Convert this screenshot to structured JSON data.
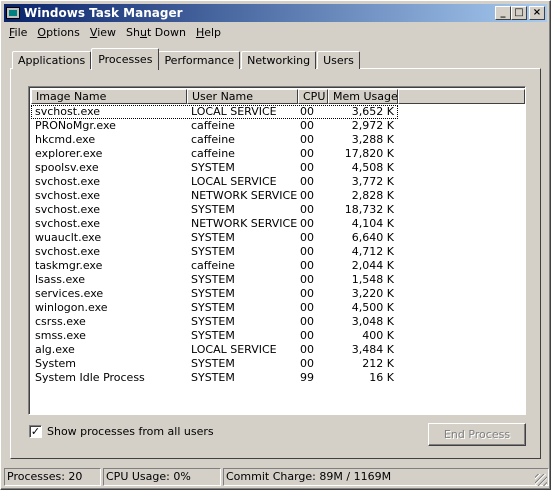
{
  "window": {
    "title": "Windows Task Manager"
  },
  "titlebar_buttons": {
    "minimize": "_",
    "maximize": "□",
    "close": "×"
  },
  "menu": [
    {
      "label": "File",
      "accel": "F",
      "rest": "ile"
    },
    {
      "label": "Options",
      "accel": "O",
      "rest": "ptions"
    },
    {
      "label": "View",
      "accel": "V",
      "rest": "iew"
    },
    {
      "label": "Shut Down",
      "accel": "",
      "pre": "Sh",
      "ul": "u",
      "post": "t Down"
    },
    {
      "label": "Help",
      "accel": "H",
      "rest": "elp"
    }
  ],
  "tabs": [
    "Applications",
    "Processes",
    "Performance",
    "Networking",
    "Users"
  ],
  "active_tab": "Processes",
  "columns": [
    "Image Name",
    "User Name",
    "CPU",
    "Mem Usage"
  ],
  "processes": [
    [
      "svchost.exe",
      "LOCAL SERVICE",
      "00",
      "3,652 K"
    ],
    [
      "PRONoMgr.exe",
      "caffeine",
      "00",
      "2,972 K"
    ],
    [
      "hkcmd.exe",
      "caffeine",
      "00",
      "3,288 K"
    ],
    [
      "explorer.exe",
      "caffeine",
      "00",
      "17,820 K"
    ],
    [
      "spoolsv.exe",
      "SYSTEM",
      "00",
      "4,508 K"
    ],
    [
      "svchost.exe",
      "LOCAL SERVICE",
      "00",
      "3,772 K"
    ],
    [
      "svchost.exe",
      "NETWORK SERVICE",
      "00",
      "2,828 K"
    ],
    [
      "svchost.exe",
      "SYSTEM",
      "00",
      "18,732 K"
    ],
    [
      "svchost.exe",
      "NETWORK SERVICE",
      "00",
      "4,104 K"
    ],
    [
      "wuauclt.exe",
      "SYSTEM",
      "00",
      "6,640 K"
    ],
    [
      "svchost.exe",
      "SYSTEM",
      "00",
      "4,712 K"
    ],
    [
      "taskmgr.exe",
      "caffeine",
      "00",
      "2,044 K"
    ],
    [
      "lsass.exe",
      "SYSTEM",
      "00",
      "1,548 K"
    ],
    [
      "services.exe",
      "SYSTEM",
      "00",
      "3,220 K"
    ],
    [
      "winlogon.exe",
      "SYSTEM",
      "00",
      "4,500 K"
    ],
    [
      "csrss.exe",
      "SYSTEM",
      "00",
      "3,048 K"
    ],
    [
      "smss.exe",
      "SYSTEM",
      "00",
      "400 K"
    ],
    [
      "alg.exe",
      "LOCAL SERVICE",
      "00",
      "3,484 K"
    ],
    [
      "System",
      "SYSTEM",
      "00",
      "212 K"
    ],
    [
      "System Idle Process",
      "SYSTEM",
      "99",
      "16 K"
    ]
  ],
  "show_all_users": {
    "label": "Show processes from all users",
    "checked": true,
    "check_glyph": "✓"
  },
  "end_process_label": "End Process",
  "status": {
    "processes": "Processes: 20",
    "cpu": "CPU Usage: 0%",
    "commit": "Commit Charge: 89M / 1169M"
  },
  "colors": {
    "title_start": "#0a246a",
    "title_end": "#a6caf0",
    "face": "#d4d0c8"
  }
}
